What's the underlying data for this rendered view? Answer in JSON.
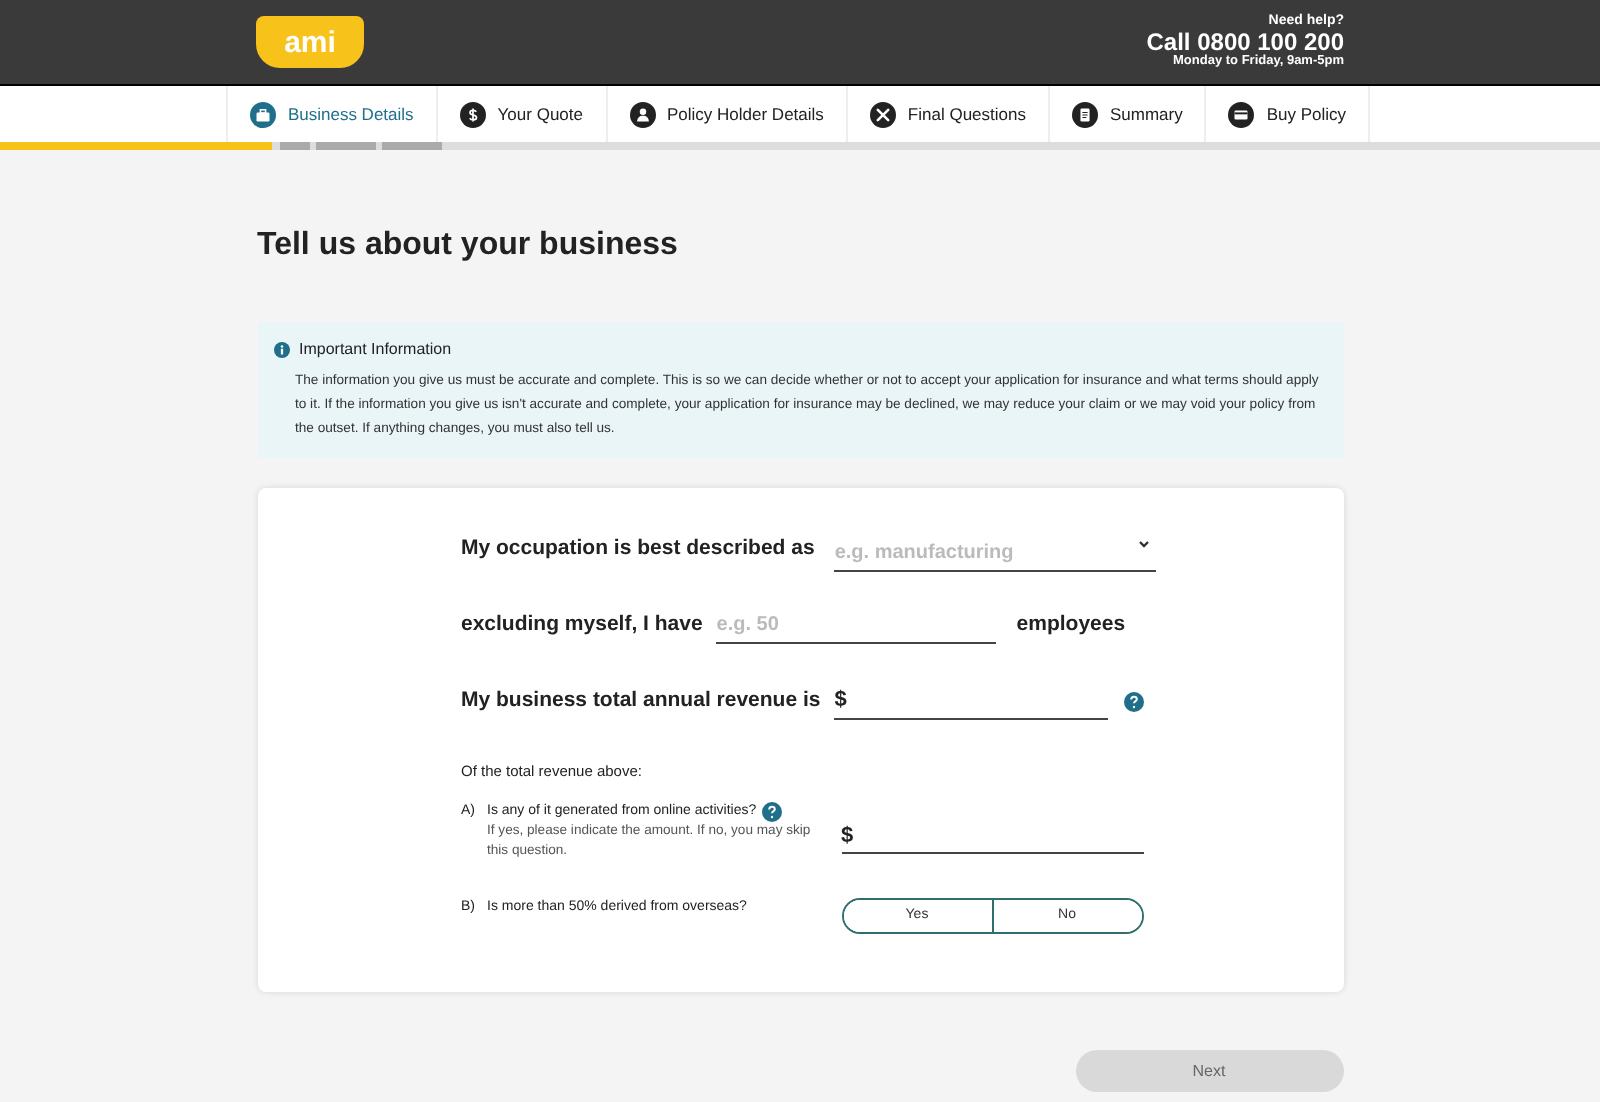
{
  "header": {
    "logo": "ami",
    "help_label": "Need help?",
    "phone": "Call 0800 100 200",
    "hours": "Monday to Friday, 9am-5pm"
  },
  "tabs": [
    {
      "label": "Business Details",
      "selected": true
    },
    {
      "label": "Your Quote",
      "selected": false
    },
    {
      "label": "Policy Holder Details",
      "selected": false
    },
    {
      "label": "Final Questions",
      "selected": false
    },
    {
      "label": "Summary",
      "selected": false
    },
    {
      "label": "Buy Policy",
      "selected": false
    }
  ],
  "progress": {
    "level": 0.17
  },
  "heading": "Tell us about your business",
  "notice": {
    "title": "Important Information",
    "body": "The information you give us must be accurate and complete. This is so we can decide whether or not to accept your application for insurance and what terms should apply to it. If the information you give us isn't accurate and complete, your application for insurance may be declined, we may reduce your claim or we may void your policy from the outset. If anything changes, you must also tell us."
  },
  "form": {
    "rows": [
      {
        "kind": "select",
        "label": "My occupation is best described as",
        "placeholder": "e.g. manufacturing"
      },
      {
        "kind": "number",
        "label": "excluding myself, I have",
        "placeholder": "e.g. 50",
        "suffix": "employees"
      },
      {
        "kind": "currency",
        "label": "My business total annual revenue is",
        "prefix": "$",
        "help": true
      }
    ],
    "subheading": "Of the total revenue above:",
    "questions": [
      {
        "kind": "currency",
        "marker": "A)",
        "question": "Is any of it generated from online activities?",
        "help": true,
        "hint": "If yes, please indicate the amount. If no, you may skip this question.",
        "prefix": "$"
      },
      {
        "kind": "toggle",
        "marker": "B)",
        "question": "Is more than 50% derived from overseas?",
        "options": [
          {
            "label": "Yes",
            "selected": false
          },
          {
            "label": "No",
            "selected": false
          }
        ]
      }
    ]
  },
  "next_button": {
    "label": "Next",
    "disabled": true
  }
}
